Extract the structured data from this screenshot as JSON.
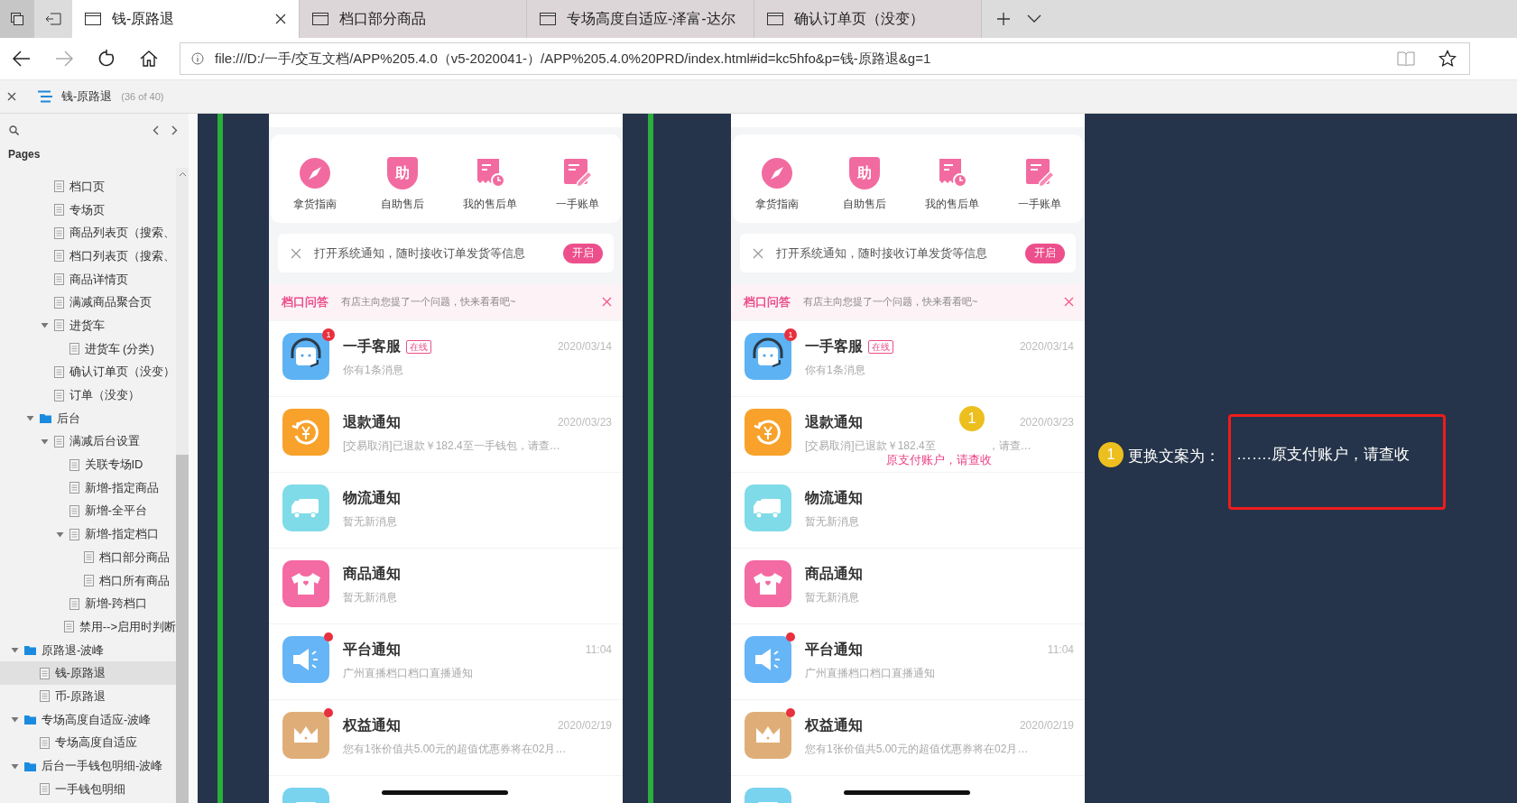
{
  "browser": {
    "tabs": [
      {
        "title": "钱-原路退",
        "selected": true
      },
      {
        "title": "档口部分商品",
        "selected": false
      },
      {
        "title": "专场高度自适应-泽富-达尔",
        "selected": false
      },
      {
        "title": "确认订单页（没变）",
        "selected": false
      }
    ],
    "nav": {
      "back_enabled": true,
      "forward_enabled": false
    },
    "address": "file:///D:/一手/交互文档/APP%205.4.0（v5-2020041-）/APP%205.4.0%20PRD/index.html#id=kc5hfo&p=钱-原路退&g=1"
  },
  "axure": {
    "page_title": "钱-原路退",
    "page_count": "(36 of 40)"
  },
  "sidebar": {
    "section": "Pages",
    "tree": [
      {
        "children": [
          {
            "children": [
              {
                "label": "档口页",
                "kind": "page",
                "selected": false
              },
              {
                "label": "专场页",
                "kind": "page",
                "selected": false
              },
              {
                "label": "商品列表页（搜索、",
                "kind": "page",
                "selected": false
              },
              {
                "label": "档口列表页（搜索、",
                "kind": "page",
                "selected": false
              },
              {
                "label": "商品详情页",
                "kind": "page",
                "selected": false
              },
              {
                "label": "满减商品聚合页",
                "kind": "page",
                "selected": false
              },
              {
                "label": "进货车",
                "kind": "page",
                "selected": false,
                "expanded": true,
                "children": [
                  {
                    "label": "进货车 (分类)",
                    "kind": "page",
                    "selected": false
                  }
                ]
              },
              {
                "label": "确认订单页（没变）",
                "kind": "page",
                "selected": false
              },
              {
                "label": "订单（没变）",
                "kind": "page",
                "selected": false
              }
            ]
          },
          {
            "label": "后台",
            "kind": "folder",
            "selected": false,
            "expanded": true,
            "children": [
              {
                "label": "满减后台设置",
                "kind": "page",
                "selected": false,
                "expanded": true,
                "children": [
                  {
                    "label": "关联专场ID",
                    "kind": "page",
                    "selected": false
                  },
                  {
                    "label": "新增-指定商品",
                    "kind": "page",
                    "selected": false
                  },
                  {
                    "label": "新增-全平台",
                    "kind": "page",
                    "selected": false
                  },
                  {
                    "label": "新增-指定档口",
                    "kind": "page",
                    "selected": false,
                    "expanded": true,
                    "children": [
                      {
                        "label": "档口部分商品",
                        "kind": "page",
                        "selected": false
                      },
                      {
                        "label": "档口所有商品",
                        "kind": "page",
                        "selected": false
                      }
                    ]
                  },
                  {
                    "label": "新增-跨档口",
                    "kind": "page",
                    "selected": false
                  },
                  {
                    "label": "禁用-->启用时判断",
                    "kind": "page",
                    "selected": false
                  }
                ]
              }
            ]
          }
        ]
      },
      {
        "label": "原路退-波峰",
        "kind": "folder",
        "selected": false,
        "expanded": true,
        "children": [
          {
            "label": "钱-原路退",
            "kind": "page",
            "selected": true
          },
          {
            "label": "币-原路退",
            "kind": "page",
            "selected": false
          }
        ]
      },
      {
        "label": "专场高度自适应-波峰",
        "kind": "folder",
        "selected": false,
        "expanded": true,
        "children": [
          {
            "label": "专场高度自适应",
            "kind": "page",
            "selected": false
          }
        ]
      },
      {
        "label": "后台一手钱包明细-波峰",
        "kind": "folder",
        "selected": false,
        "expanded": true,
        "children": [
          {
            "label": "一手钱包明细",
            "kind": "page",
            "selected": false
          }
        ]
      }
    ]
  },
  "phones": [
    {
      "quick_actions": [
        {
          "kind": "compass",
          "label": "拿货指南"
        },
        {
          "kind": "shield",
          "icon_char": "助",
          "label": "自助售后"
        },
        {
          "kind": "receipt",
          "label": "我的售后单"
        },
        {
          "kind": "bill",
          "label": "一手账单"
        }
      ],
      "notice": {
        "text": "打开系统通知，随时接收订单发货等信息",
        "button": "开启"
      },
      "banner": {
        "title": "档口问答",
        "text": "有店主向您提了一个问题，快来看看吧~"
      },
      "rows": [
        {
          "kind": "service",
          "title": "一手客服",
          "tag": "在线",
          "date": "2020/03/14",
          "subtitle": "你有1条消息",
          "count": "1",
          "unread_dot": false
        },
        {
          "kind": "refund",
          "title": "退款通知",
          "date": "2020/03/23",
          "subtitle": "[交易取消]已退款￥182.4至一手钱包，请查…",
          "unread_dot": false
        },
        {
          "kind": "truck",
          "title": "物流通知",
          "subtitle": "暂无新消息",
          "unread_dot": false
        },
        {
          "kind": "shirt",
          "title": "商品通知",
          "subtitle": "暂无新消息",
          "unread_dot": false
        },
        {
          "kind": "megaphone",
          "title": "平台通知",
          "date": "11:04",
          "subtitle": "广州直播档口档口直播通知",
          "unread_dot": true
        },
        {
          "kind": "crown",
          "title": "权益通知",
          "date": "2020/02/19",
          "subtitle": "您有1张价值共5.00元的超值优惠券将在02月…",
          "unread_dot": true
        },
        {
          "kind": "chat",
          "unread_dot": false
        }
      ]
    },
    {
      "quick_actions": [
        {
          "kind": "compass",
          "label": "拿货指南"
        },
        {
          "kind": "shield",
          "icon_char": "助",
          "label": "自助售后"
        },
        {
          "kind": "receipt",
          "label": "我的售后单"
        },
        {
          "kind": "bill",
          "label": "一手账单"
        }
      ],
      "notice": {
        "text": "打开系统通知，随时接收订单发货等信息",
        "button": "开启"
      },
      "banner": {
        "title": "档口问答",
        "text": "有店主向您提了一个问题，快来看看吧~"
      },
      "rows": [
        {
          "kind": "service",
          "title": "一手客服",
          "tag": "在线",
          "date": "2020/03/14",
          "subtitle": "你有1条消息",
          "count": "1",
          "unread_dot": false
        },
        {
          "kind": "refund",
          "title": "退款通知",
          "date": "2020/03/23",
          "subtitle": "[交易取消]已退款￥182.4至",
          "subtitle_tail": "，请查…",
          "unread_dot": false
        },
        {
          "kind": "truck",
          "title": "物流通知",
          "subtitle": "暂无新消息",
          "unread_dot": false
        },
        {
          "kind": "shirt",
          "title": "商品通知",
          "subtitle": "暂无新消息",
          "unread_dot": false
        },
        {
          "kind": "megaphone",
          "title": "平台通知",
          "date": "11:04",
          "subtitle": "广州直播档口档口直播通知",
          "unread_dot": true
        },
        {
          "kind": "crown",
          "title": "权益通知",
          "date": "2020/02/19",
          "subtitle": "您有1张价值共5.00元的超值优惠券将在02月…",
          "unread_dot": true
        },
        {
          "kind": "chat",
          "unread_dot": false
        }
      ],
      "annotation": {
        "number": "1",
        "text": "原支付账户，请查收"
      }
    }
  ],
  "note": {
    "number": "1",
    "label": "更换文案为：",
    "text": "…….原支付账户，请查收"
  }
}
